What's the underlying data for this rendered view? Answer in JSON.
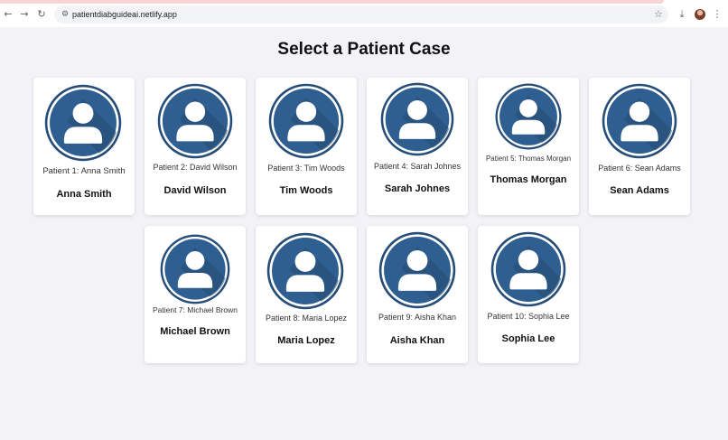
{
  "browser": {
    "url": "patientdiabguideai.netlify.app",
    "back_icon": "arrow-left-icon",
    "forward_icon": "arrow-right-icon",
    "reload_icon": "reload-icon",
    "bookmark_icon": "star-icon",
    "download_icon": "download-icon",
    "menu_icon": "kebab-menu-icon"
  },
  "page": {
    "title": "Select a Patient Case"
  },
  "patients": [
    {
      "subtitle": "Patient 1: Anna Smith",
      "name": "Anna Smith"
    },
    {
      "subtitle": "Patient 2: David Wilson",
      "name": "David Wilson"
    },
    {
      "subtitle": "Patient 3: Tim Woods",
      "name": "Tim Woods"
    },
    {
      "subtitle": "Patient 4: Sarah Johnes",
      "name": "Sarah Johnes"
    },
    {
      "subtitle": "Patient 5: Thomas Morgan",
      "name": "Thomas Morgan"
    },
    {
      "subtitle": "Patient 6: Sean Adams",
      "name": "Sean Adams"
    },
    {
      "subtitle": "Patient 7: Michael Brown",
      "name": "Michael Brown"
    },
    {
      "subtitle": "Patient 8: Maria Lopez",
      "name": "Maria Lopez"
    },
    {
      "subtitle": "Patient 9: Aisha Khan",
      "name": "Aisha Khan"
    },
    {
      "subtitle": "Patient 10: Sophia Lee",
      "name": "Sophia Lee"
    }
  ],
  "colors": {
    "avatar_blue": "#2f5f90",
    "avatar_ring": "#264d77",
    "avatar_shadow": "#244a73"
  }
}
